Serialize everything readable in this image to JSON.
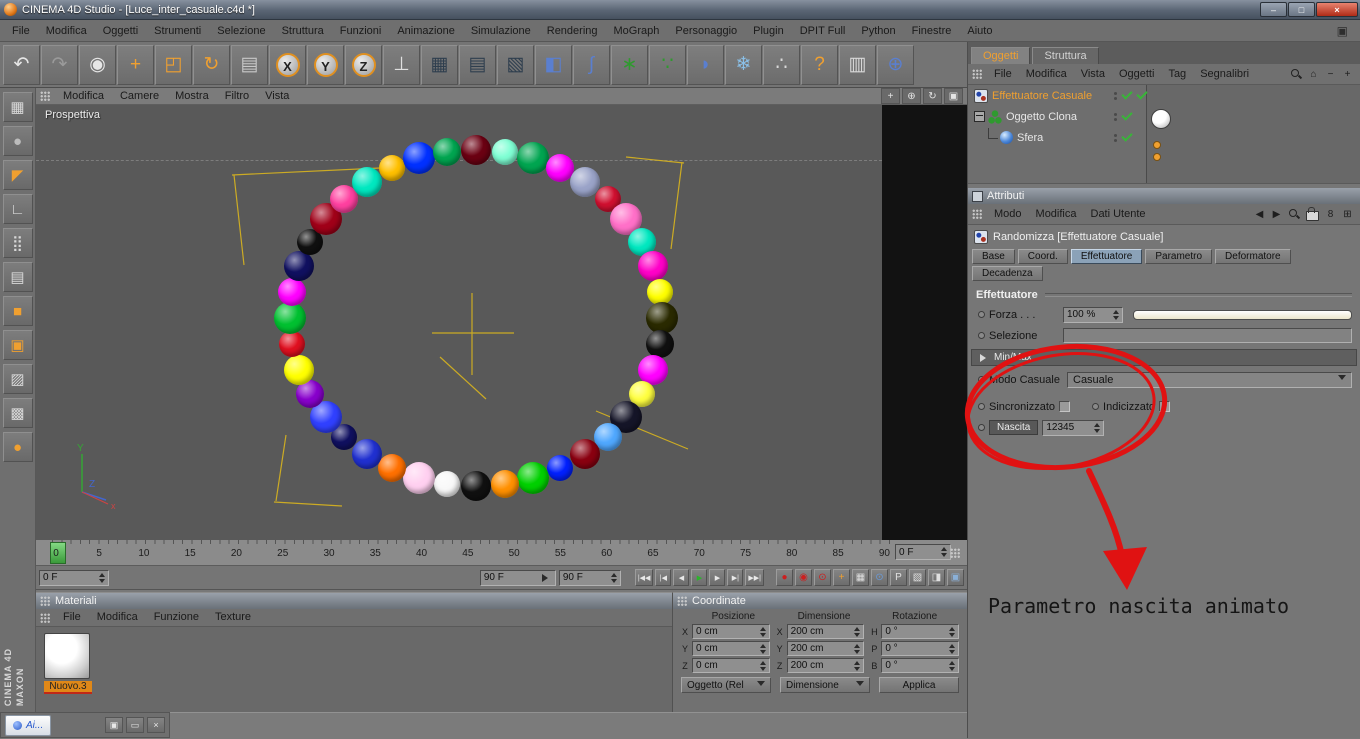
{
  "theme": {
    "accent_orange": "#f0a030",
    "active_tab_blue": "#8ba2b8",
    "check_green": "#38b538",
    "annotation_red": "#e01212"
  },
  "window": {
    "title": "CINEMA 4D Studio - [Luce_inter_casuale.c4d *]",
    "controls": {
      "minimize": "–",
      "maximize": "□",
      "close": "×"
    }
  },
  "menubar": [
    "File",
    "Modifica",
    "Oggetti",
    "Strumenti",
    "Selezione",
    "Struttura",
    "Funzioni",
    "Animazione",
    "Simulazione",
    "Rendering",
    "MoGraph",
    "Personaggio",
    "Plugin",
    "DPIT Full",
    "Python",
    "Finestre",
    "Aiuto"
  ],
  "menubar_right": {
    "glyph": "▣"
  },
  "toolbar": [
    {
      "name": "undo-icon",
      "glyph": "↶",
      "color": "#e6e6e6"
    },
    {
      "name": "redo-icon",
      "glyph": "↷",
      "color": "#9a9a9a"
    },
    {
      "name": "live-selection-icon",
      "glyph": "◉",
      "color": "#e6e6e6"
    },
    {
      "name": "move-tool-icon",
      "glyph": "+",
      "color": "#f0a030"
    },
    {
      "name": "scale-tool-icon",
      "glyph": "◰",
      "color": "#f0a030"
    },
    {
      "name": "rotate-tool-icon",
      "glyph": "↻",
      "color": "#f0a030"
    },
    {
      "name": "last-tool-icon",
      "glyph": "▤",
      "color": "#c8c8c8"
    },
    {
      "name": "lock-x-axis-icon",
      "glyph": "X",
      "color": "#222222",
      "circle": true
    },
    {
      "name": "lock-y-axis-icon",
      "glyph": "Y",
      "color": "#222222",
      "circle": true
    },
    {
      "name": "lock-z-axis-icon",
      "glyph": "Z",
      "color": "#222222",
      "circle": true
    },
    {
      "name": "coordinate-system-icon",
      "glyph": "⊥",
      "color": "#e0e0e0"
    },
    {
      "name": "render-view-icon",
      "glyph": "▦",
      "color": "#2e3e4e"
    },
    {
      "name": "render-picture-viewer-icon",
      "glyph": "▤",
      "color": "#2e3e4e"
    },
    {
      "name": "render-settings-icon",
      "glyph": "▧",
      "color": "#2e3e4e"
    },
    {
      "name": "primitive-cube-icon",
      "glyph": "◧",
      "color": "#5a7fd0"
    },
    {
      "name": "spline-pen-icon",
      "glyph": "∫",
      "color": "#5a7fd0"
    },
    {
      "name": "mograph-cloner-icon",
      "glyph": "∗",
      "color": "#2f9a2f"
    },
    {
      "name": "mograph-effector-icon",
      "glyph": "∵",
      "color": "#2f9a2f"
    },
    {
      "name": "deformer-icon",
      "glyph": "◗",
      "color": "#5a7fd0"
    },
    {
      "name": "simulation-icon",
      "glyph": "❄",
      "color": "#8ac0e8"
    },
    {
      "name": "particles-icon",
      "glyph": "∴",
      "color": "#d8d8d8"
    },
    {
      "name": "help-icon",
      "glyph": "?",
      "color": "#f0a030"
    },
    {
      "name": "content-browser-icon",
      "glyph": "▥",
      "color": "#d8d8d8"
    },
    {
      "name": "online-help-icon",
      "glyph": "⊕",
      "color": "#5a7fd0"
    }
  ],
  "left_toolbar": [
    {
      "name": "layout-grid-icon",
      "glyph": "▦",
      "color": "#d8d8d8"
    },
    {
      "name": "viewport-ball-icon",
      "glyph": "●",
      "color": "#bcbcbc"
    },
    {
      "name": "make-editable-icon",
      "glyph": "◤",
      "color": "#f0a030"
    },
    {
      "name": "object-axis-icon",
      "glyph": "∟",
      "color": "#d8d8d8"
    },
    {
      "name": "points-mode-icon",
      "glyph": "⣿",
      "color": "#d8d8d8"
    },
    {
      "name": "edges-mode-icon",
      "glyph": "▤",
      "color": "#d8d8d8"
    },
    {
      "name": "polygons-mode-icon",
      "glyph": "■",
      "color": "#f0a030"
    },
    {
      "name": "model-mode-icon",
      "glyph": "▣",
      "color": "#f0a030"
    },
    {
      "name": "texture-mode-icon",
      "glyph": "▨",
      "color": "#d8d8d8"
    },
    {
      "name": "texture-axis-mode-icon",
      "glyph": "▩",
      "color": "#d8d8d8"
    },
    {
      "name": "object-mode-icon",
      "glyph": "●",
      "color": "#f0a030"
    }
  ],
  "viewport": {
    "label": "Prospettiva",
    "menu": [
      "Modifica",
      "Camere",
      "Mostra",
      "Filtro",
      "Vista"
    ],
    "nav_icons": [
      {
        "name": "pan-view-icon",
        "glyph": "+"
      },
      {
        "name": "zoom-view-icon",
        "glyph": "⊕"
      },
      {
        "name": "rotate-view-icon",
        "glyph": "↻"
      },
      {
        "name": "toggle-panel-icon",
        "glyph": "▣"
      }
    ],
    "axis_labels": {
      "x": "x",
      "y": "Y",
      "z": "Z"
    },
    "sphere_colors": [
      "#6b0012",
      "#7fffd4",
      "#00a550",
      "#ff00ff",
      "#9aa3c8",
      "#d01030",
      "#ff70c8",
      "#00e8c0",
      "#ff00c8",
      "#ffff00",
      "#2a2a00",
      "#101010",
      "#ff00ff",
      "#ffff40",
      "#151528",
      "#50a8ff",
      "#8a0010",
      "#0020ff",
      "#00d000",
      "#ff9000",
      "#101010",
      "#f8f8f8",
      "#ffd0f0",
      "#ff7000",
      "#2030d0",
      "#101060",
      "#3040ff",
      "#8800cc",
      "#ffff00",
      "#e01020",
      "#00c030",
      "#ff00ff",
      "#101060",
      "#101010",
      "#a00018",
      "#ff40a0",
      "#00e8c0",
      "#ffc000",
      "#0030ff",
      "#00a550"
    ]
  },
  "timeline": {
    "ticks": [
      "0",
      "5",
      "10",
      "15",
      "20",
      "25",
      "30",
      "35",
      "40",
      "45",
      "50",
      "55",
      "60",
      "65",
      "70",
      "75",
      "80",
      "85",
      "90"
    ],
    "frame_field": "0 F"
  },
  "transport": {
    "current": "0 F",
    "range_end": "90 F",
    "end": "90 F",
    "buttons": [
      {
        "name": "goto-start-button",
        "glyph": "|◀◀",
        "color": "#e8e8e8"
      },
      {
        "name": "prev-key-button",
        "glyph": "|◀",
        "color": "#e8e8e8"
      },
      {
        "name": "prev-frame-button",
        "glyph": "◀",
        "color": "#e8e8e8"
      },
      {
        "name": "play-button",
        "glyph": "▶",
        "color": "#2bb52b"
      },
      {
        "name": "next-frame-button",
        "glyph": "▶",
        "color": "#e8e8e8"
      },
      {
        "name": "next-key-button",
        "glyph": "▶|",
        "color": "#e8e8e8"
      },
      {
        "name": "goto-end-button",
        "glyph": "▶▶|",
        "color": "#e8e8e8"
      }
    ],
    "key_buttons": [
      {
        "name": "record-keyframe-button",
        "glyph": "●",
        "color": "#cc2020"
      },
      {
        "name": "record-position-button",
        "glyph": "◉",
        "color": "#cc2020"
      },
      {
        "name": "record-rotation-button",
        "glyph": "⊙",
        "color": "#cc2020"
      },
      {
        "name": "autokey-button",
        "glyph": "+",
        "color": "#f0a030"
      },
      {
        "name": "keyframe-presets-button",
        "glyph": "▦",
        "color": "#e0e0e0"
      },
      {
        "name": "timeline-window-button",
        "glyph": "⊙",
        "color": "#6a9ad8"
      },
      {
        "name": "powerslider-options-button",
        "glyph": "P",
        "color": "#e0e0e0"
      },
      {
        "name": "render-marker-button",
        "glyph": "▧",
        "color": "#e0e0e0"
      },
      {
        "name": "half-view-button",
        "glyph": "◨",
        "color": "#e0e0e0"
      },
      {
        "name": "layout-switch-button",
        "glyph": "▣",
        "color": "#8ab0d8"
      }
    ]
  },
  "materials": {
    "header": "Materiali",
    "menu": [
      "File",
      "Modifica",
      "Funzione",
      "Texture"
    ],
    "material_name": "Nuovo.3"
  },
  "coordinates": {
    "header": "Coordinate",
    "columns": [
      "Posizione",
      "Dimensione",
      "Rotazione"
    ],
    "rows": [
      {
        "pos_label": "X",
        "pos": "0 cm",
        "dim_label": "X",
        "dim": "200 cm",
        "rot_label": "H",
        "rot": "0 °"
      },
      {
        "pos_label": "Y",
        "pos": "0 cm",
        "dim_label": "Y",
        "dim": "200 cm",
        "rot_label": "P",
        "rot": "0 °"
      },
      {
        "pos_label": "Z",
        "pos": "0 cm",
        "dim_label": "Z",
        "dim": "200 cm",
        "rot_label": "B",
        "rot": "0 °"
      }
    ],
    "mode1": "Oggetto (Rel",
    "mode2": "Dimensione",
    "apply": "Applica"
  },
  "object_manager": {
    "tabs": [
      {
        "label": "Oggetti",
        "active": true
      },
      {
        "label": "Struttura",
        "active": false
      }
    ],
    "menu": [
      "File",
      "Modifica",
      "Vista",
      "Oggetti",
      "Tag",
      "Segnalibri"
    ],
    "menu_icons": [
      {
        "name": "search-icon",
        "cls": "icon-search",
        "glyph": ""
      },
      {
        "name": "home-icon",
        "glyph": "⌂"
      },
      {
        "name": "collapse-all-icon",
        "glyph": "−"
      },
      {
        "name": "expand-all-icon",
        "glyph": "+"
      }
    ],
    "tree": [
      {
        "label": "Effettuatore Casuale"
      },
      {
        "label": "Oggetto Clona"
      },
      {
        "label": "Sfera"
      }
    ]
  },
  "attributes": {
    "header": "Attributi",
    "menu": [
      "Modo",
      "Modifica",
      "Dati Utente"
    ],
    "menu_icons": [
      {
        "name": "history-back-icon",
        "glyph": "◀"
      },
      {
        "name": "history-forward-icon",
        "glyph": "▶"
      },
      {
        "name": "search-icon",
        "cls": "icon-search",
        "glyph": ""
      },
      {
        "name": "lock-icon",
        "cls": "icon-lock",
        "glyph": ""
      },
      {
        "name": "bookmark-icon",
        "glyph": "8"
      },
      {
        "name": "new-window-icon",
        "glyph": "⊞"
      }
    ],
    "title": "Randomizza [Effettuatore Casuale]",
    "tabs_row1": [
      {
        "label": "Base"
      },
      {
        "label": "Coord."
      },
      {
        "label": "Effettuatore",
        "active": true
      },
      {
        "label": "Parametro"
      },
      {
        "label": "Deformatore"
      }
    ],
    "tabs_row2": [
      {
        "label": "Decadenza"
      }
    ],
    "section": "Effettuatore",
    "forza": {
      "label": "Forza . . .",
      "value": "100 %"
    },
    "selezione": {
      "label": "Selezione"
    },
    "minmax": {
      "label": "Min/Max"
    },
    "modo": {
      "label": "Modo Casuale",
      "value": "Casuale"
    },
    "sincronizzato": {
      "label": "Sincronizzato",
      "checked": false
    },
    "indicizzato": {
      "label": "Indicizzato",
      "checked": false
    },
    "nascita": {
      "label": "Nascita",
      "value": "12345"
    }
  },
  "annotation": {
    "text": "Parametro nascita animato"
  },
  "branding": {
    "line1": "MAXON",
    "line2": "CINEMA 4D"
  },
  "taskbar": {
    "label": "Ai...",
    "icons": [
      {
        "name": "restore-window-icon",
        "glyph": "▣"
      },
      {
        "name": "minimize-window-icon",
        "glyph": "▭"
      },
      {
        "name": "close-window-icon",
        "glyph": "×"
      }
    ]
  }
}
